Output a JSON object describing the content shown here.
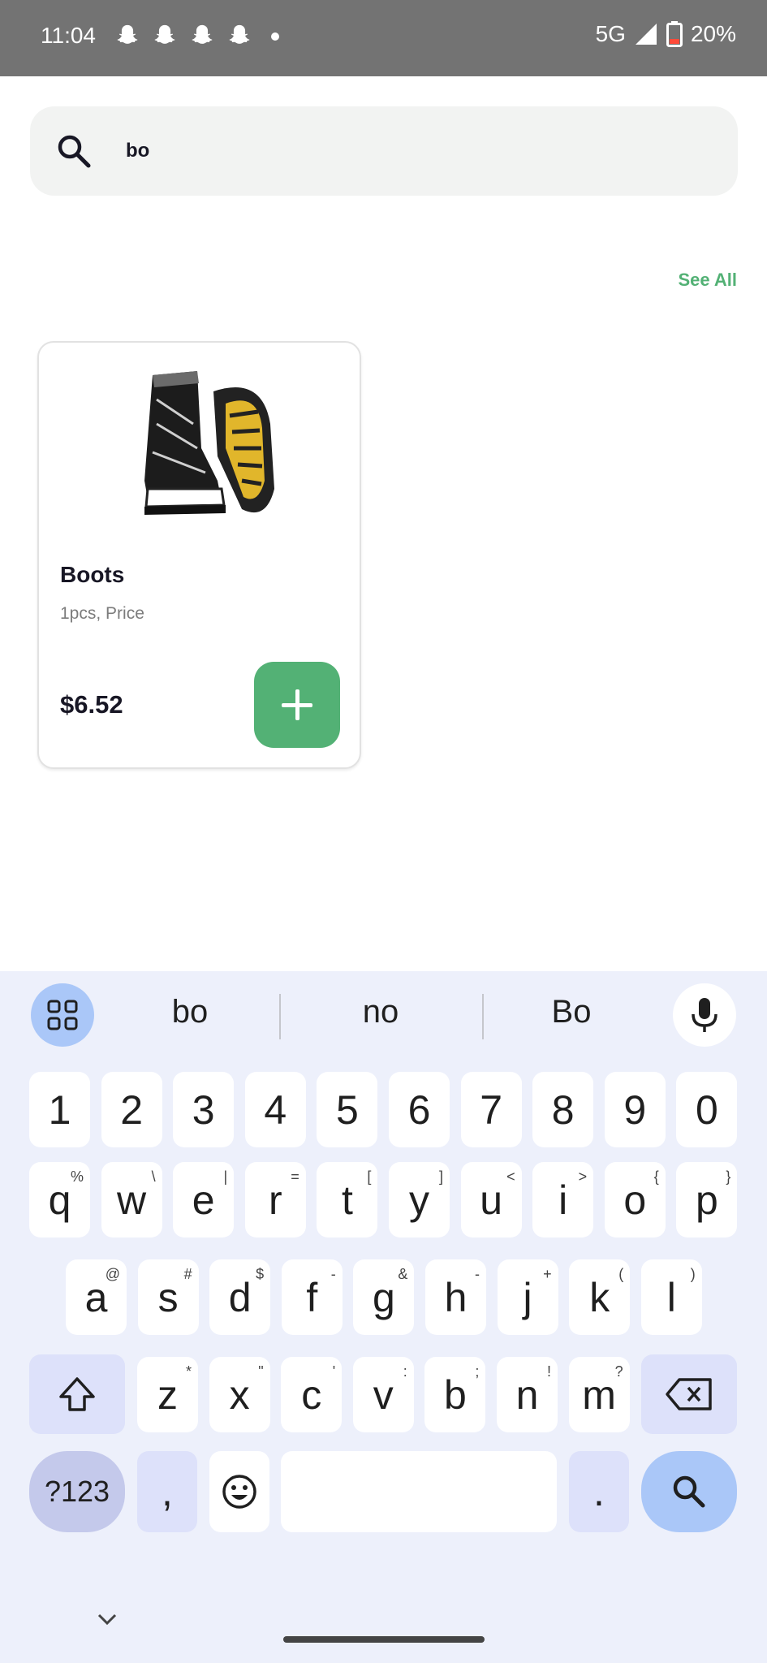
{
  "status_bar": {
    "time": "11:04",
    "network": "5G",
    "battery": "20%",
    "notification_icons": [
      "snapchat-icon",
      "snapchat-icon",
      "snapchat-icon",
      "snapchat-icon"
    ]
  },
  "search": {
    "value": "bo",
    "icon": "search-icon"
  },
  "section": {
    "see_all": "See All"
  },
  "products": [
    {
      "name": "Boots",
      "unit": "1pcs, Price",
      "price": "$6.52",
      "image": "boots-image",
      "action": "add-to-cart"
    }
  ],
  "keyboard": {
    "suggestions": [
      "bo",
      "no",
      "Bo"
    ],
    "number_row": [
      "1",
      "2",
      "3",
      "4",
      "5",
      "6",
      "7",
      "8",
      "9",
      "0"
    ],
    "row1": [
      {
        "k": "q",
        "s": "%"
      },
      {
        "k": "w",
        "s": "\\"
      },
      {
        "k": "e",
        "s": "|"
      },
      {
        "k": "r",
        "s": "="
      },
      {
        "k": "t",
        "s": "["
      },
      {
        "k": "y",
        "s": "]"
      },
      {
        "k": "u",
        "s": "<"
      },
      {
        "k": "i",
        "s": ">"
      },
      {
        "k": "o",
        "s": "{"
      },
      {
        "k": "p",
        "s": "}"
      }
    ],
    "row2": [
      {
        "k": "a",
        "s": "@"
      },
      {
        "k": "s",
        "s": "#"
      },
      {
        "k": "d",
        "s": "$"
      },
      {
        "k": "f",
        "s": "-"
      },
      {
        "k": "g",
        "s": "&"
      },
      {
        "k": "h",
        "s": "-"
      },
      {
        "k": "j",
        "s": "+"
      },
      {
        "k": "k",
        "s": "("
      },
      {
        "k": "l",
        "s": ")"
      }
    ],
    "row3": [
      {
        "k": "z",
        "s": "*"
      },
      {
        "k": "x",
        "s": "\""
      },
      {
        "k": "c",
        "s": "'"
      },
      {
        "k": "v",
        "s": ":"
      },
      {
        "k": "b",
        "s": ";"
      },
      {
        "k": "n",
        "s": "!"
      },
      {
        "k": "m",
        "s": "?"
      }
    ],
    "symbols_label": "?123",
    "comma": ",",
    "period": "."
  }
}
